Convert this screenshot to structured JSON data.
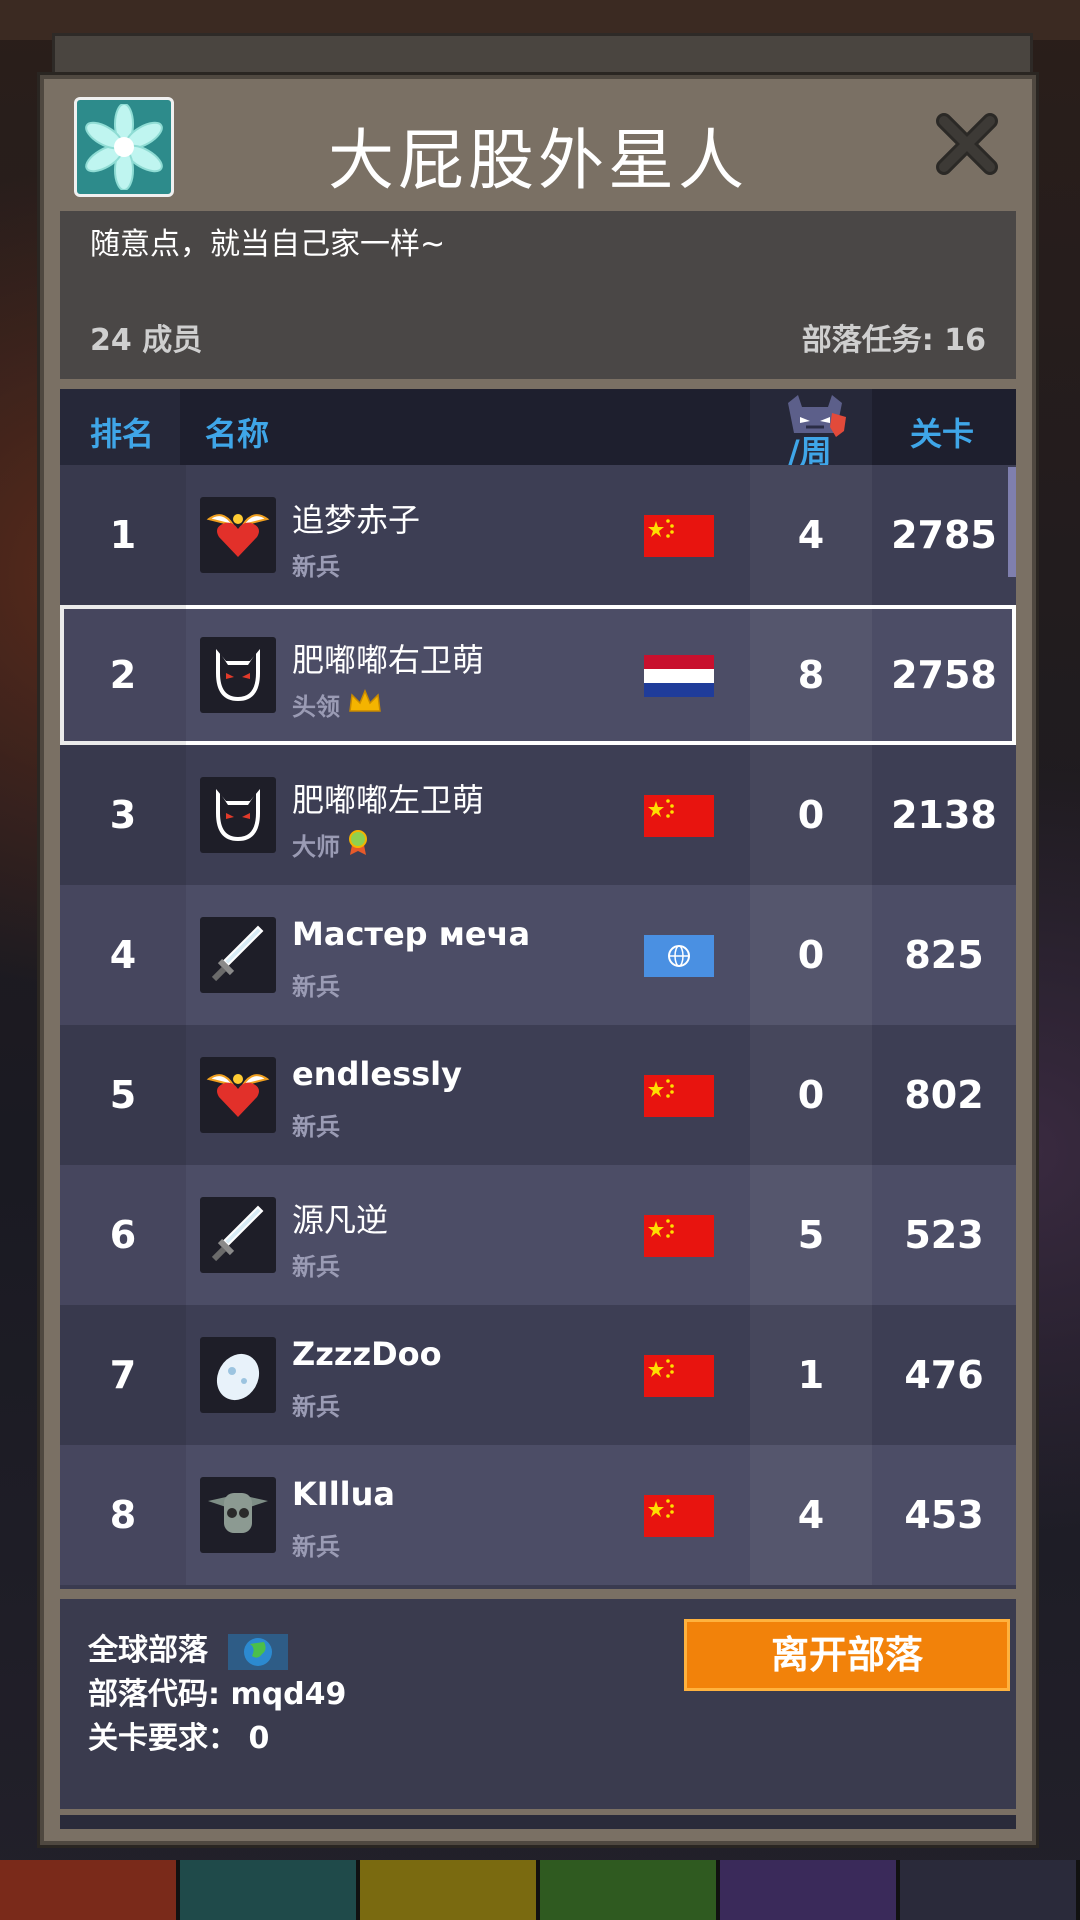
{
  "clan": {
    "title": "大屁股外星人",
    "description": "随意点，就当自己家一样~",
    "members": "24 成员",
    "quest": "部落任务: 16"
  },
  "table": {
    "headers": {
      "rank": "排名",
      "name": "名称",
      "week": "/周",
      "level": "关卡"
    },
    "rows": [
      {
        "rank": "1",
        "name": "追梦赤子",
        "role": "新兵",
        "avatar": "heart-wings-icon",
        "flag": "china-flag-icon",
        "week": "4",
        "level": "2785"
      },
      {
        "rank": "2",
        "name": "肥嘟嘟右卫萌",
        "role": "头领",
        "avatar": "devil-face-icon",
        "flag": "netherlands-flag-icon",
        "week": "8",
        "level": "2758",
        "badge": "crown-icon"
      },
      {
        "rank": "3",
        "name": "肥嘟嘟左卫萌",
        "role": "大师",
        "avatar": "devil-face-icon",
        "flag": "china-flag-icon",
        "week": "0",
        "level": "2138",
        "badge": "medal-icon"
      },
      {
        "rank": "4",
        "name": "Мастер меча",
        "role": "新兵",
        "avatar": "sword-icon",
        "flag": "globe-flag-icon",
        "week": "0",
        "level": "825"
      },
      {
        "rank": "5",
        "name": "endlessly",
        "role": "新兵",
        "avatar": "heart-wings-icon",
        "flag": "china-flag-icon",
        "week": "0",
        "level": "802"
      },
      {
        "rank": "6",
        "name": "源凡逆",
        "role": "新兵",
        "avatar": "sword-icon",
        "flag": "china-flag-icon",
        "week": "5",
        "level": "523"
      },
      {
        "rank": "7",
        "name": "ZzzzDoo",
        "role": "新兵",
        "avatar": "egg-icon",
        "flag": "china-flag-icon",
        "week": "1",
        "level": "476"
      },
      {
        "rank": "8",
        "name": "KIllua",
        "role": "新兵",
        "avatar": "goblin-skull-icon",
        "flag": "china-flag-icon",
        "week": "4",
        "level": "453"
      }
    ],
    "selected_rank": "2"
  },
  "footer": {
    "global": "全球部落",
    "code": "部落代码: mqd49",
    "requirement": "关卡要求： 0",
    "leave_button": "离开部落"
  },
  "colors": {
    "accent_blue": "#3fa6e8",
    "leave_orange": "#f2820a",
    "panel": "#7a7064"
  }
}
